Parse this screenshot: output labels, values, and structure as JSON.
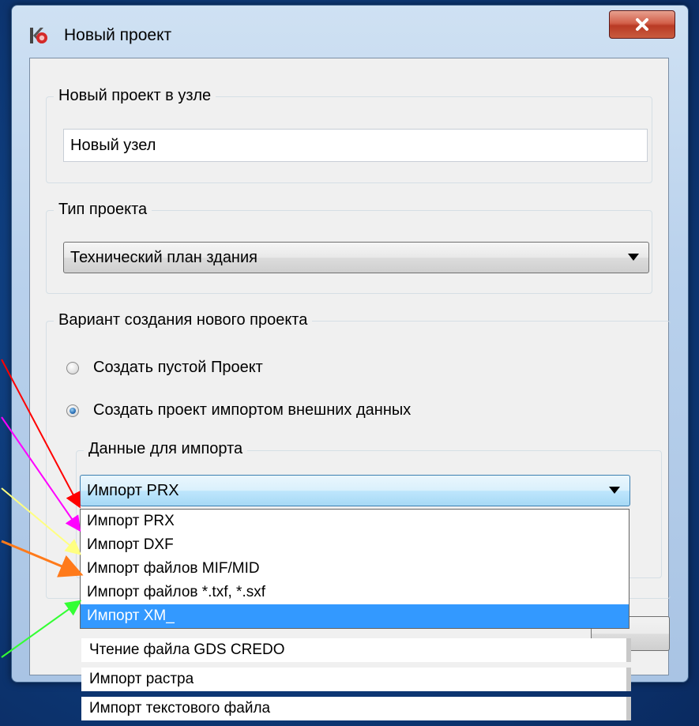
{
  "window": {
    "title": "Новый проект",
    "close_symbol": "X",
    "icon": "app-logo-icon"
  },
  "group_node": {
    "legend": "Новый проект в узле",
    "input_value": "Новый узел"
  },
  "group_type": {
    "legend": "Тип проекта",
    "selected": "Технический план здания"
  },
  "group_variant": {
    "legend": "Вариант создания нового проекта",
    "options": [
      {
        "label": "Создать пустой Проект",
        "checked": false
      },
      {
        "label": "Создать проект импортом внешних данных",
        "checked": true
      }
    ]
  },
  "group_import": {
    "legend": "Данные для импорта",
    "selected": "Импорт PRX"
  },
  "dropdown": {
    "items": [
      {
        "label": "Импорт PRX",
        "selected": false
      },
      {
        "label": "Импорт DXF",
        "selected": false
      },
      {
        "label": "Импорт файлов MIF/MID",
        "selected": false
      },
      {
        "label": "Импорт файлов *.txf, *.sxf",
        "selected": false
      },
      {
        "label": "Импорт XM_",
        "selected": true
      }
    ],
    "extra_items": [
      "Чтение файла GDS CREDO",
      "Импорт растра",
      "Импорт текстового файла"
    ]
  },
  "annotation_arrows": {
    "colors": [
      "#ff0000",
      "#ff00ff",
      "#ffff80",
      "#ff7a1a",
      "#33ff33"
    ]
  }
}
